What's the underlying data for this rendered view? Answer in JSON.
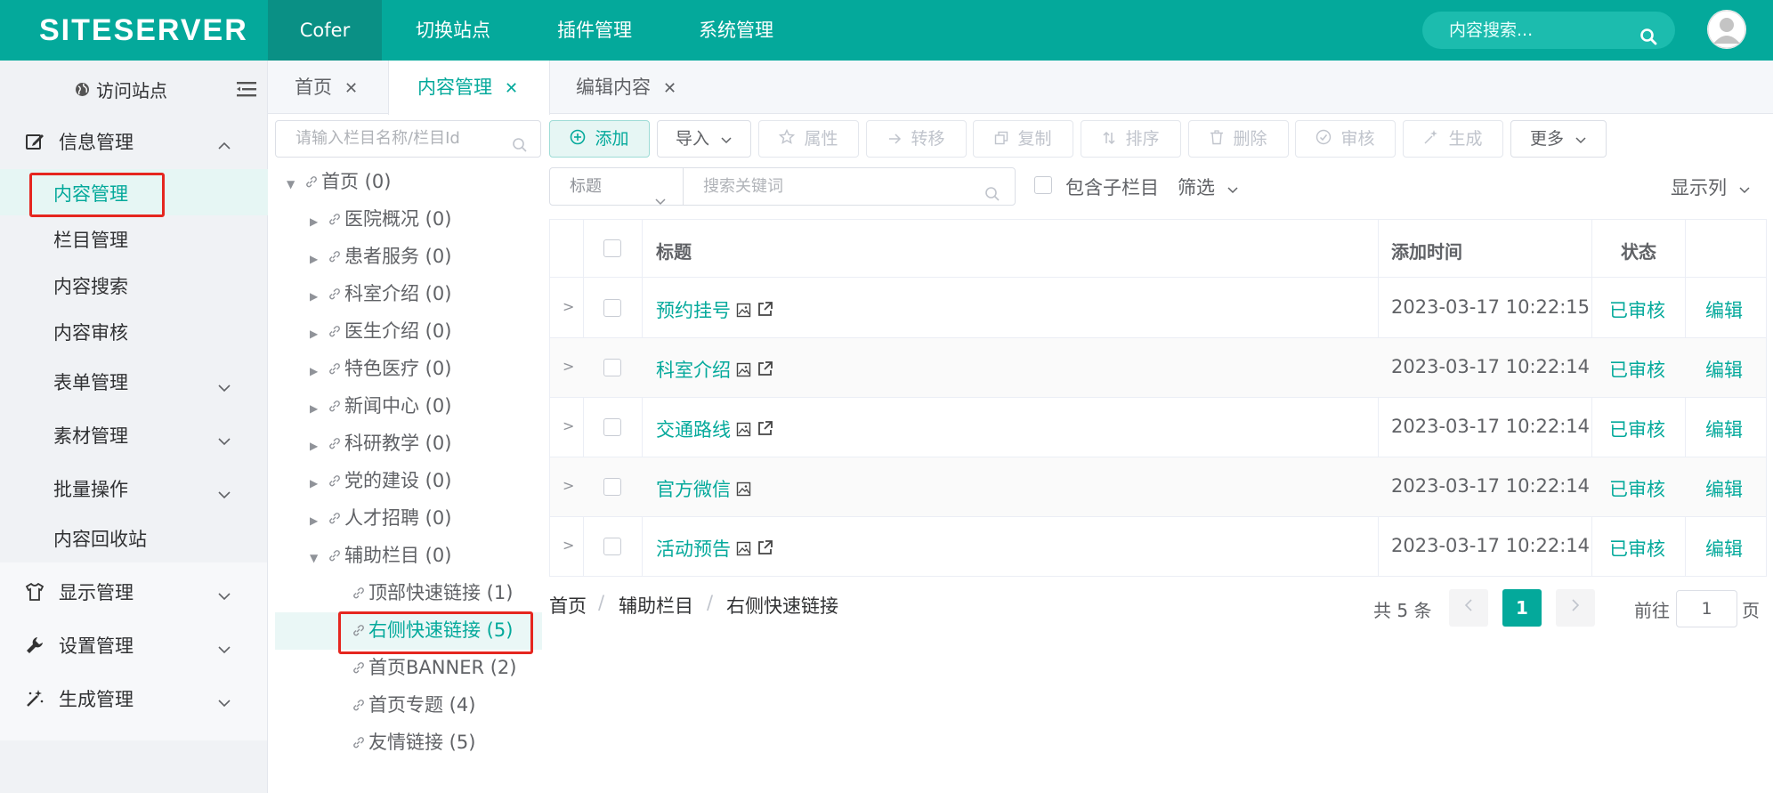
{
  "brand": {
    "logo": "SITESERVER",
    "accent": "#04a99b"
  },
  "topnav": {
    "items": [
      "Cofer",
      "切换站点",
      "插件管理",
      "系统管理"
    ],
    "search_placeholder": "内容搜索..."
  },
  "leftmenu": {
    "visit_site": "访问站点",
    "info_group": "信息管理",
    "info_items": [
      "内容管理",
      "栏目管理",
      "内容搜索",
      "内容审核",
      "表单管理",
      "素材管理",
      "批量操作",
      "内容回收站"
    ],
    "groups": [
      "显示管理",
      "设置管理",
      "生成管理"
    ]
  },
  "tabs": [
    {
      "label": "首页"
    },
    {
      "label": "内容管理"
    },
    {
      "label": "编辑内容"
    }
  ],
  "tree": {
    "search_placeholder": "请输入栏目名称/栏目Id",
    "nodes": [
      "首页 (0)",
      "医院概况 (0)",
      "患者服务 (0)",
      "科室介绍 (0)",
      "医生介绍 (0)",
      "特色医疗 (0)",
      "新闻中心 (0)",
      "科研教学 (0)",
      "党的建设 (0)",
      "人才招聘 (0)",
      "辅助栏目 (0)",
      "顶部快速链接 (1)",
      "右侧快速链接 (5)",
      "首页BANNER (2)",
      "首页专题 (4)",
      "友情链接 (5)"
    ],
    "selected": "右侧快速链接 (5)"
  },
  "toolbar": {
    "add": "添加",
    "import": "导入",
    "attributes": "属性",
    "transfer": "转移",
    "copy": "复制",
    "sort": "排序",
    "delete": "删除",
    "review": "审核",
    "generate": "生成",
    "more": "更多"
  },
  "filter": {
    "field_select": "标题",
    "keyword_placeholder": "搜索关键词",
    "include_children": "包含子栏目",
    "filter_label": "筛选",
    "columns_label": "显示列"
  },
  "table": {
    "headers": {
      "title": "标题",
      "added_time": "添加时间",
      "status": "状态"
    },
    "rows": [
      {
        "title": "预约挂号",
        "time": "2023-03-17 10:22:15",
        "status": "已审核",
        "edit": "编辑"
      },
      {
        "title": "科室介绍",
        "time": "2023-03-17 10:22:14",
        "status": "已审核",
        "edit": "编辑"
      },
      {
        "title": "交通路线",
        "time": "2023-03-17 10:22:14",
        "status": "已审核",
        "edit": "编辑"
      },
      {
        "title": "官方微信",
        "time": "2023-03-17 10:22:14",
        "status": "已审核",
        "edit": "编辑"
      },
      {
        "title": "活动预告",
        "time": "2023-03-17 10:22:14",
        "status": "已审核",
        "edit": "编辑"
      }
    ]
  },
  "breadcrumb": [
    "首页",
    "辅助栏目",
    "右侧快速链接"
  ],
  "pagination": {
    "total": "共 5 条",
    "current": "1",
    "goto_prefix": "前往",
    "goto_value": "1",
    "goto_suffix": "页"
  }
}
